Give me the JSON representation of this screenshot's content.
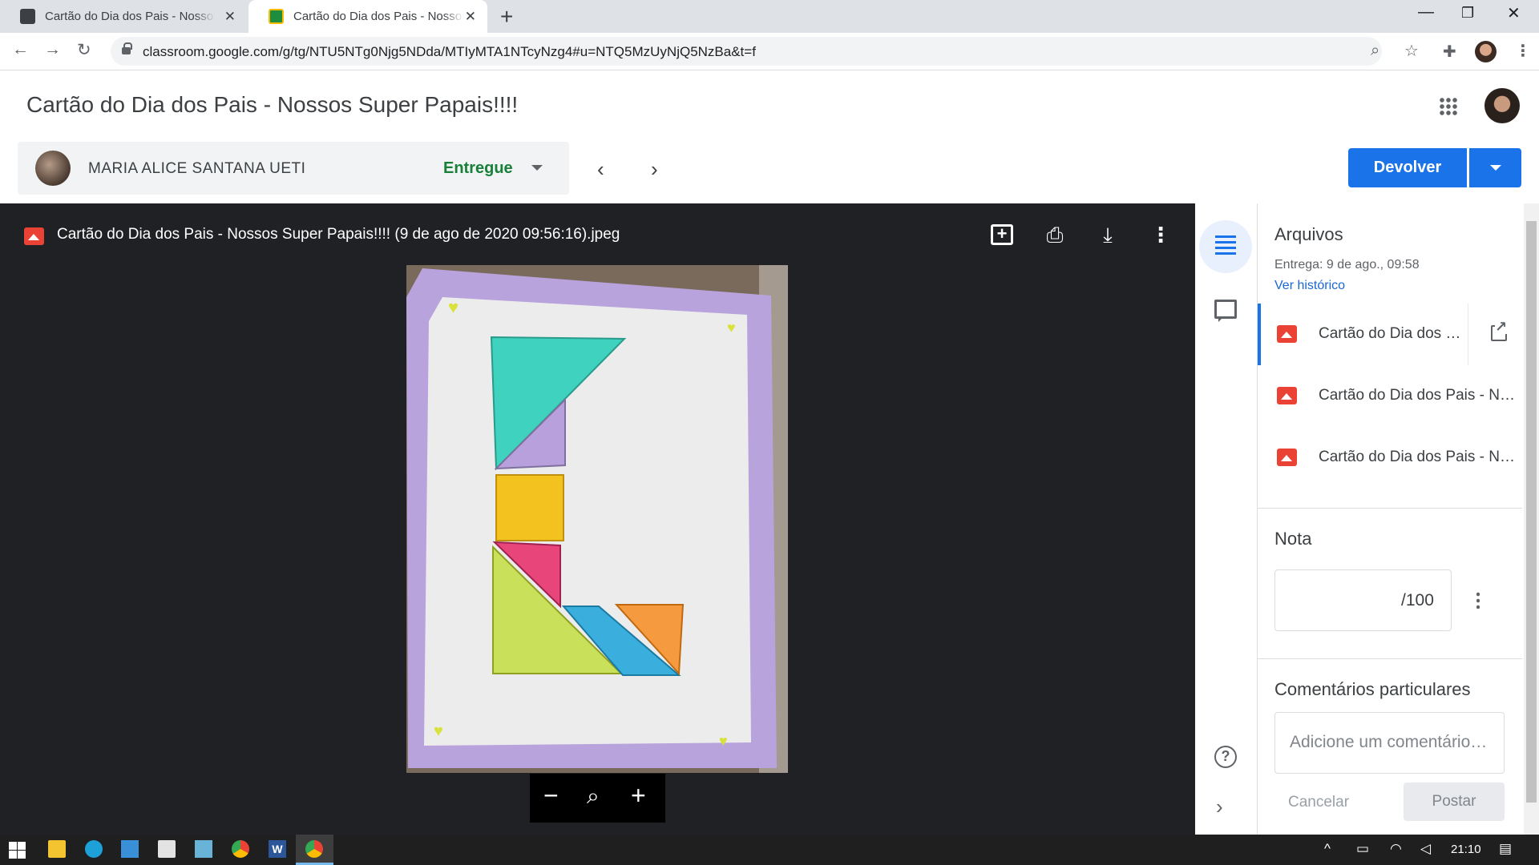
{
  "browser": {
    "tabs": [
      {
        "title": "Cartão do Dia dos Pais - Nossos Super Papais!!!!"
      },
      {
        "title": "Cartão do Dia dos Pais - Nossos Super Papais!!!!"
      }
    ],
    "url": "classroom.google.com/g/tg/NTU5NTg0Njg5NDda/MTIyMTA1NTcyNzg4#u=NTQ5MzUyNjQ5NzBa&t=f"
  },
  "header": {
    "title": "Cartão do Dia dos Pais - Nossos Super Papais!!!!"
  },
  "student": {
    "name": "MARIA ALICE SANTANA UETI",
    "status": "Entregue"
  },
  "actions": {
    "return_label": "Devolver"
  },
  "viewer": {
    "file_title": "Cartão do Dia dos Pais - Nossos Super Papais!!!! (9 de ago de 2020 09:56:16).jpeg"
  },
  "panel": {
    "files_heading": "Arquivos",
    "submitted": "Entrega: 9 de ago., 09:58",
    "history_link": "Ver histórico",
    "files": [
      {
        "name": "Cartão do Dia dos Pais - Nossos Super Papais!!!!"
      },
      {
        "name": "Cartão do Dia dos Pais - Nossos Super Papais!!!!"
      },
      {
        "name": "Cartão do Dia dos Pais - Nossos Super Papais!!!!"
      }
    ],
    "grade_heading": "Nota",
    "grade_suffix": "/100",
    "comments_heading": "Comentários particulares",
    "comment_placeholder": "Adicione um comentário particular...",
    "cancel_label": "Cancelar",
    "post_label": "Postar"
  },
  "taskbar": {
    "time": "21:10",
    "word_letter": "W"
  },
  "colors": {
    "accent": "#1a73e8",
    "status_green": "#188038",
    "viewer_bg": "#202124"
  }
}
